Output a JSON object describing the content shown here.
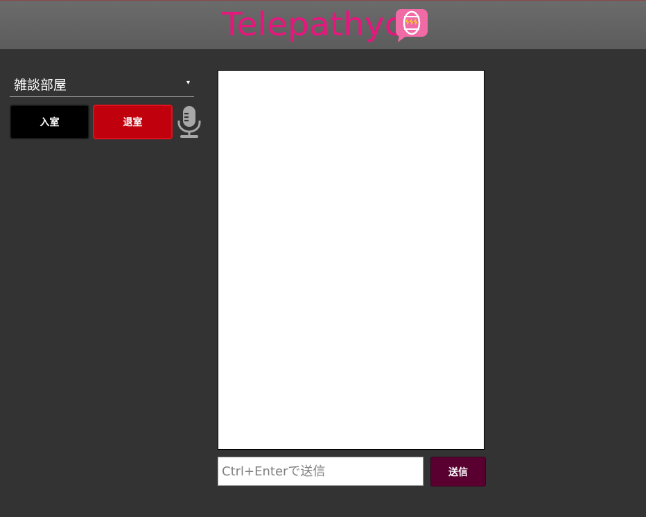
{
  "app": {
    "brand_name": "Telepathyc",
    "brand_color": "#e6167d",
    "brand_icon": "speech-bubble-head-icon"
  },
  "room": {
    "selected": "雑談部屋",
    "dropdown_arrow": "▾"
  },
  "controls": {
    "enter_label": "入室",
    "leave_label": "退室",
    "mic_icon": "microphone-icon"
  },
  "chat": {
    "messages": []
  },
  "composer": {
    "placeholder": "Ctrl+Enterで送信",
    "value": "",
    "send_label": "送信"
  },
  "colors": {
    "background": "#333333",
    "header": "#5c5c5c",
    "enter_button": "#000000",
    "leave_button": "#c0000d",
    "send_button": "#5a0030"
  }
}
